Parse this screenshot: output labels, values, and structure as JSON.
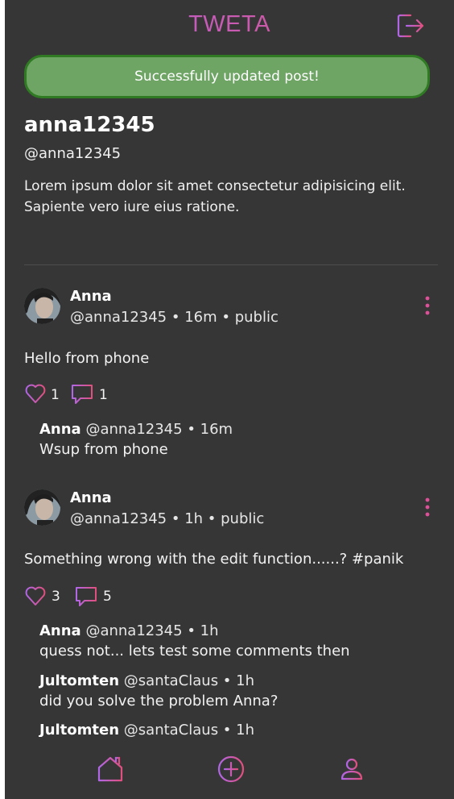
{
  "app": {
    "logo": "TWETA",
    "accent_start": "#b066e6",
    "accent_end": "#e0507e"
  },
  "header": {
    "logout_icon": "logout-icon"
  },
  "toast": {
    "message": "Successfully updated post!"
  },
  "profile": {
    "name": "anna12345",
    "handle": "@anna12345",
    "bio": "Lorem ipsum dolor sit amet consectetur adipisicing elit. Sapiente vero iure eius ratione."
  },
  "posts": [
    {
      "author": "Anna",
      "meta": "@anna12345 • 16m • public",
      "text": "Hello from phone",
      "likes": "1",
      "comments_count": "1",
      "comments": [
        {
          "author": "Anna",
          "meta": "@anna12345 • 16m",
          "text": "Wsup from phone"
        }
      ]
    },
    {
      "author": "Anna",
      "meta": "@anna12345 • 1h • public",
      "text": "Something wrong with the edit function......? #panik",
      "likes": "3",
      "comments_count": "5",
      "comments": [
        {
          "author": "Anna",
          "meta": "@anna12345 • 1h",
          "text": "quess not... lets test some comments then"
        },
        {
          "author": "Jultomten",
          "meta": "@santaClaus • 1h",
          "text": "did you solve the problem Anna?"
        },
        {
          "author": "Jultomten",
          "meta": "@santaClaus • 1h",
          "text": ""
        }
      ]
    }
  ],
  "nav": {
    "home_icon": "home-icon",
    "new_post_icon": "add-post-icon",
    "profile_icon": "profile-icon"
  }
}
